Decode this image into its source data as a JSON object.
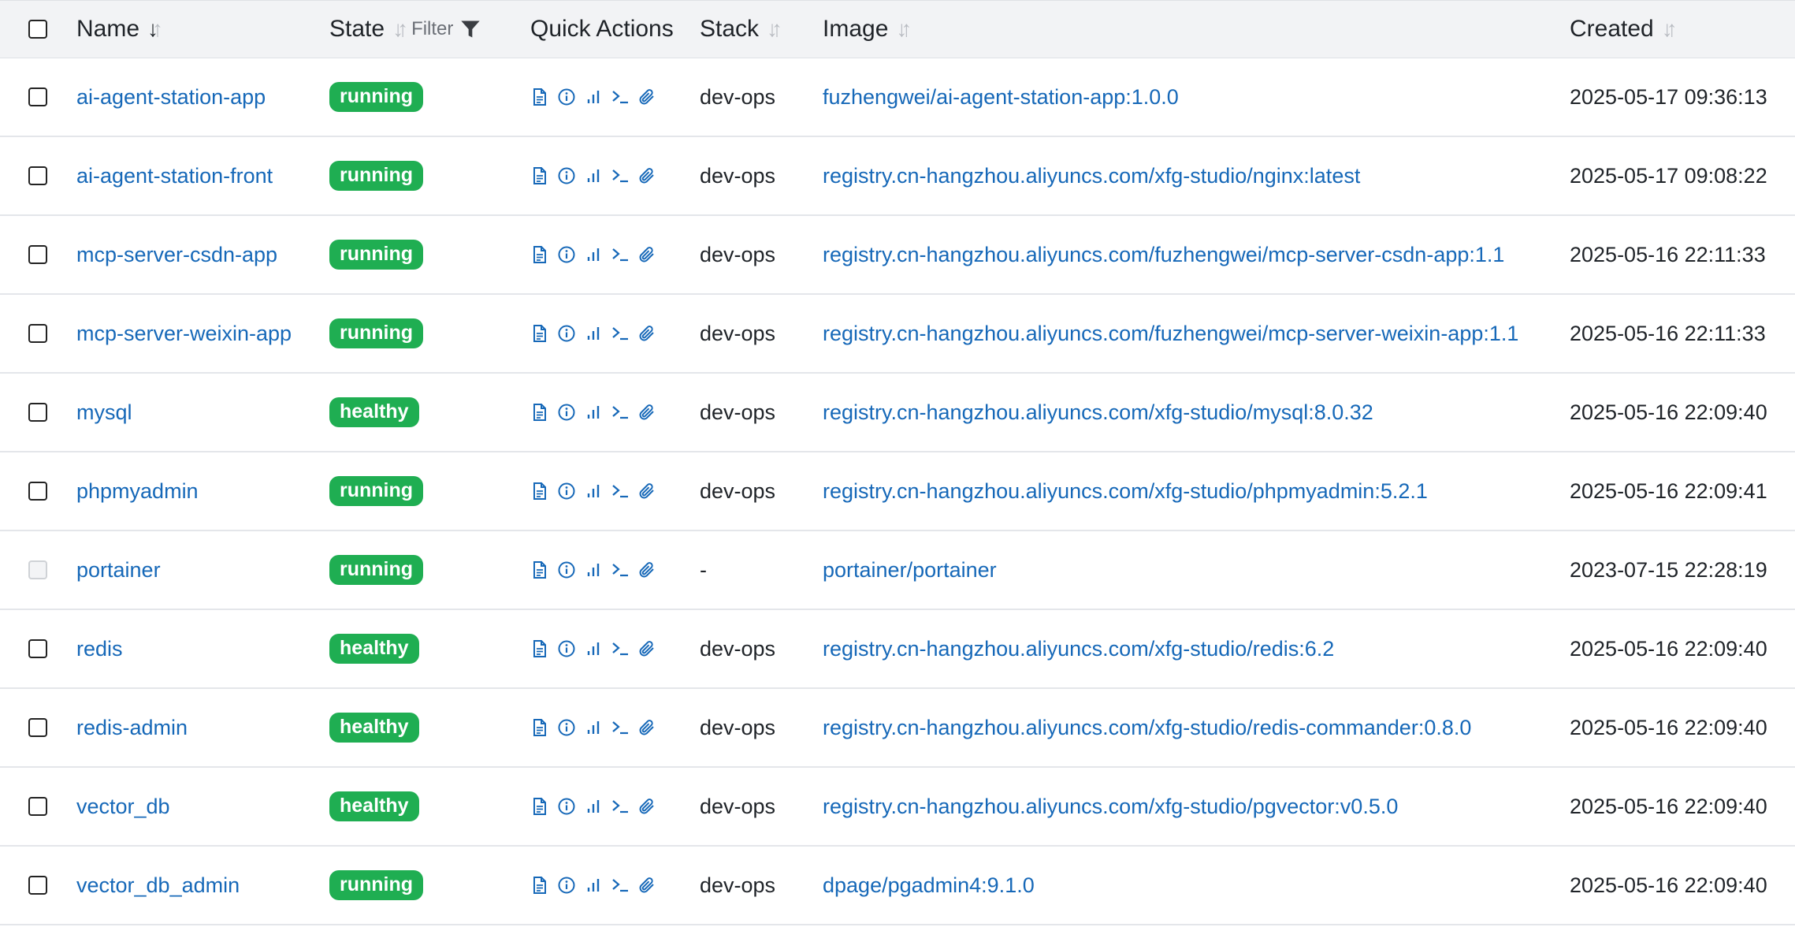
{
  "header": {
    "name": "Name",
    "state": "State",
    "filter": "Filter",
    "quick_actions": "Quick Actions",
    "stack": "Stack",
    "image": "Image",
    "created": "Created"
  },
  "colors": {
    "link": "#1668b8",
    "badge_green": "#1fae52",
    "header_bg": "#f2f3f5"
  },
  "quick_action_icons": [
    "logs-icon",
    "inspect-icon",
    "stats-icon",
    "console-icon",
    "attach-icon"
  ],
  "rows": [
    {
      "name": "ai-agent-station-app",
      "state": "running",
      "stack": "dev-ops",
      "image": "fuzhengwei/ai-agent-station-app:1.0.0",
      "created": "2025-05-17 09:36:13"
    },
    {
      "name": "ai-agent-station-front",
      "state": "running",
      "stack": "dev-ops",
      "image": "registry.cn-hangzhou.aliyuncs.com/xfg-studio/nginx:latest",
      "created": "2025-05-17 09:08:22"
    },
    {
      "name": "mcp-server-csdn-app",
      "state": "running",
      "stack": "dev-ops",
      "image": "registry.cn-hangzhou.aliyuncs.com/fuzhengwei/mcp-server-csdn-app:1.1",
      "created": "2025-05-16 22:11:33"
    },
    {
      "name": "mcp-server-weixin-app",
      "state": "running",
      "stack": "dev-ops",
      "image": "registry.cn-hangzhou.aliyuncs.com/fuzhengwei/mcp-server-weixin-app:1.1",
      "created": "2025-05-16 22:11:33"
    },
    {
      "name": "mysql",
      "state": "healthy",
      "stack": "dev-ops",
      "image": "registry.cn-hangzhou.aliyuncs.com/xfg-studio/mysql:8.0.32",
      "created": "2025-05-16 22:09:40"
    },
    {
      "name": "phpmyadmin",
      "state": "running",
      "stack": "dev-ops",
      "image": "registry.cn-hangzhou.aliyuncs.com/xfg-studio/phpmyadmin:5.2.1",
      "created": "2025-05-16 22:09:41"
    },
    {
      "name": "portainer",
      "state": "running",
      "stack": "-",
      "image": "portainer/portainer",
      "created": "2023-07-15 22:28:19",
      "checkbox_disabled": true
    },
    {
      "name": "redis",
      "state": "healthy",
      "stack": "dev-ops",
      "image": "registry.cn-hangzhou.aliyuncs.com/xfg-studio/redis:6.2",
      "created": "2025-05-16 22:09:40"
    },
    {
      "name": "redis-admin",
      "state": "healthy",
      "stack": "dev-ops",
      "image": "registry.cn-hangzhou.aliyuncs.com/xfg-studio/redis-commander:0.8.0",
      "created": "2025-05-16 22:09:40"
    },
    {
      "name": "vector_db",
      "state": "healthy",
      "stack": "dev-ops",
      "image": "registry.cn-hangzhou.aliyuncs.com/xfg-studio/pgvector:v0.5.0",
      "created": "2025-05-16 22:09:40"
    },
    {
      "name": "vector_db_admin",
      "state": "running",
      "stack": "dev-ops",
      "image": "dpage/pgadmin4:9.1.0",
      "created": "2025-05-16 22:09:40"
    }
  ]
}
